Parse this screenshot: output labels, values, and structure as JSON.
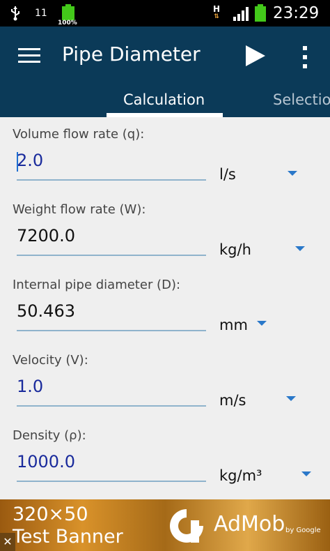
{
  "status_bar": {
    "notification_text": "11",
    "battery_label": "100%",
    "network_label": "H",
    "clock": "23:29"
  },
  "app_bar": {
    "title": "Pipe Diameter",
    "menu_icon": "hamburger-menu-icon",
    "run_icon": "play-icon",
    "overflow_icon": "more-vert-icon"
  },
  "tabs": [
    {
      "label": "Calculation",
      "selected": true
    },
    {
      "label": "Selectio",
      "selected": false
    }
  ],
  "fields": [
    {
      "label": "Volume flow rate (q):",
      "value": "2.0",
      "unit": "l/s",
      "value_color": "#1a2b9c"
    },
    {
      "label": "Weight flow rate (W):",
      "value": "7200.0",
      "unit": "kg/h",
      "value_color": "#111111"
    },
    {
      "label": "Internal pipe diameter (D):",
      "value": "50.463",
      "unit": "mm",
      "value_color": "#111111"
    },
    {
      "label": "Velocity (V):",
      "value": "1.0",
      "unit": "m/s",
      "value_color": "#1a2b9c"
    },
    {
      "label": "Density (ρ):",
      "value": "1000.0",
      "unit": "kg/m³",
      "value_color": "#1a2b9c"
    }
  ],
  "ad": {
    "line1": "320×50",
    "line2": "Test Banner",
    "brand": "AdMob",
    "by": "by Google",
    "close_icon": "close-icon"
  },
  "colors": {
    "app_bar": "#0b3a58",
    "tab_indicator": "#ffffff",
    "accent_blue": "#2a78c9",
    "field_underline": "#8fb3cc",
    "content_bg": "#efefef"
  }
}
